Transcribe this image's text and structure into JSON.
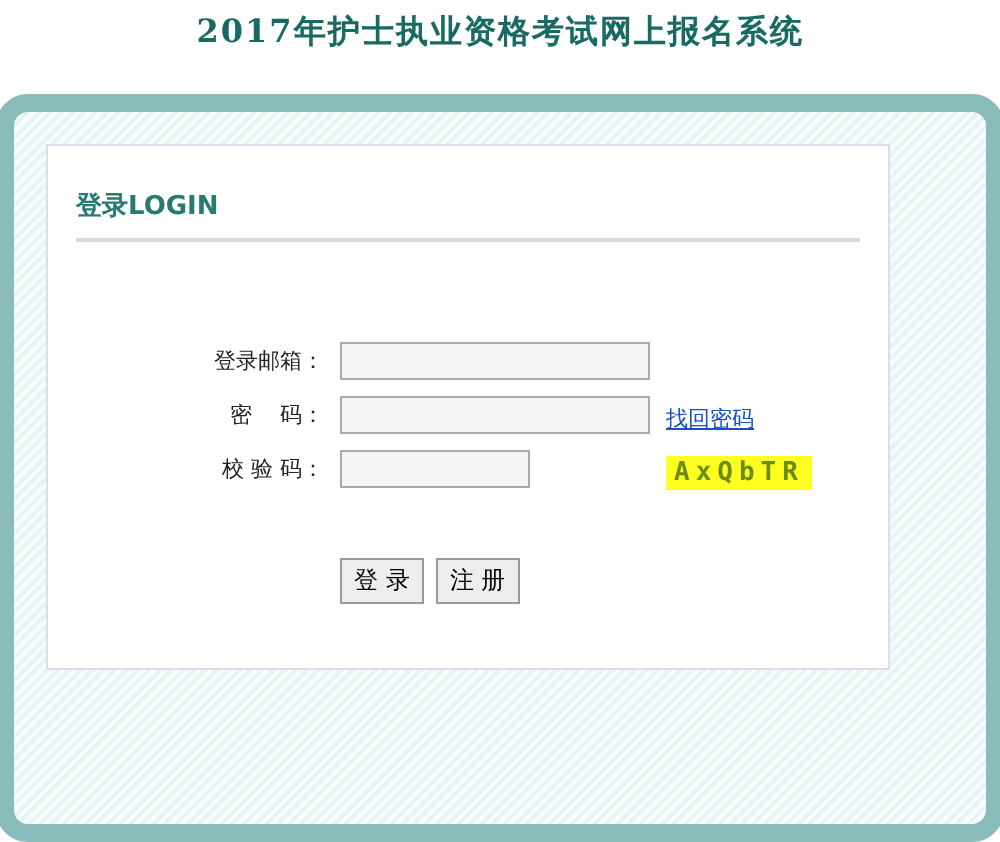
{
  "title": "2017年护士执业资格考试网上报名系统",
  "login": {
    "heading": "登录LOGIN",
    "fields": [
      {
        "label": "登录邮箱：",
        "kind": "text"
      },
      {
        "label": "密    码：",
        "kind": "password",
        "link": "找回密码"
      },
      {
        "label": "校 验 码：",
        "kind": "captcha",
        "captcha": "AxQbTR"
      }
    ],
    "buttons": [
      "登 录",
      "注 册"
    ]
  }
}
